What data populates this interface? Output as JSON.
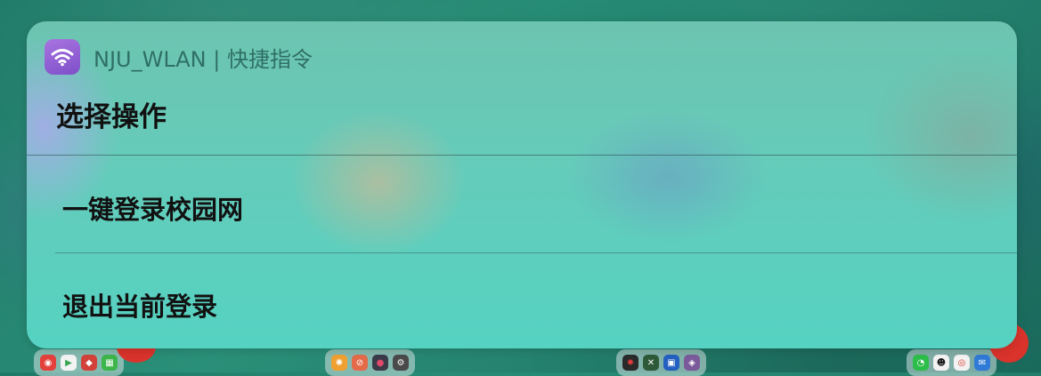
{
  "widget": {
    "app_name": "NJU_WLAN | 快捷指令",
    "app_icon": "wifi-icon",
    "icon_color": "#9b66dc",
    "prompt": "选择操作",
    "actions": [
      {
        "label": "一键登录校园网"
      },
      {
        "label": "退出当前登录"
      }
    ]
  },
  "dock": {
    "groups": [
      {
        "apps": [
          "netease-music-icon",
          "video-app-icon",
          "food-app-icon",
          "news-app-icon"
        ]
      },
      {
        "apps": [
          "sun-app-icon",
          "safari-icon",
          "raspberry-app-icon",
          "settings-icon"
        ]
      },
      {
        "apps": [
          "game-app-icon",
          "xbox-app-icon",
          "photo-app-icon",
          "game2-app-icon"
        ]
      },
      {
        "apps": [
          "wechat-icon",
          "qq-icon",
          "weibo-icon",
          "mail-app-icon"
        ]
      }
    ]
  }
}
